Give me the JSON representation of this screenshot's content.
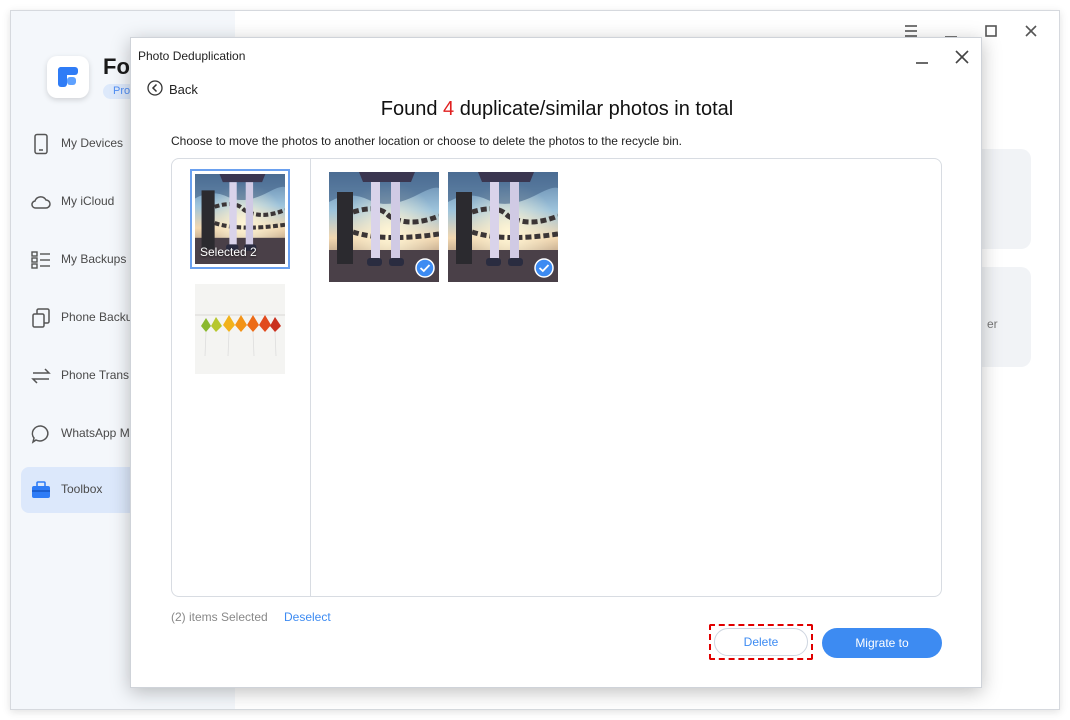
{
  "app": {
    "name": "Fo",
    "badge": "Pro",
    "sidebar": [
      {
        "label": "My Devices",
        "icon": "phone-icon"
      },
      {
        "label": "My iCloud",
        "icon": "cloud-icon"
      },
      {
        "label": "My Backups",
        "icon": "list-icon"
      },
      {
        "label": "Phone Backu",
        "icon": "copy-icon"
      },
      {
        "label": "Phone Trans",
        "icon": "transfer-arrows-icon"
      },
      {
        "label": "WhatsApp Ma",
        "icon": "chat-bubble-icon"
      },
      {
        "label": "Toolbox",
        "icon": "toolbox-icon",
        "active": true
      }
    ],
    "partial_card_text": "er",
    "window_controls": [
      "menu-icon",
      "minimize-icon",
      "maximize-icon",
      "close-icon"
    ],
    "accent_color": "#3d8bf2"
  },
  "dialog": {
    "title": "Photo Deduplication",
    "back_label": "Back",
    "headline_prefix": "Found",
    "headline_count": "4",
    "headline_suffix": "duplicate/similar photos in total",
    "instruction": "Choose to move the photos to another location or choose to delete the photos to the recycle bin.",
    "groups": [
      {
        "caption": "Selected 2",
        "selected": true,
        "image": "girl-chain-sunset-photo"
      },
      {
        "caption": "",
        "selected": false,
        "image": "autumn-leaves-photo"
      }
    ],
    "photos": [
      {
        "image": "girl-chain-sunset-photo",
        "checked": true
      },
      {
        "image": "girl-chain-sunset-photo",
        "checked": true
      }
    ],
    "selected_text": "(2) items Selected",
    "deselect_label": "Deselect",
    "delete_label": "Delete",
    "migrate_label": "Migrate to",
    "highlight_color": "#e00000"
  }
}
